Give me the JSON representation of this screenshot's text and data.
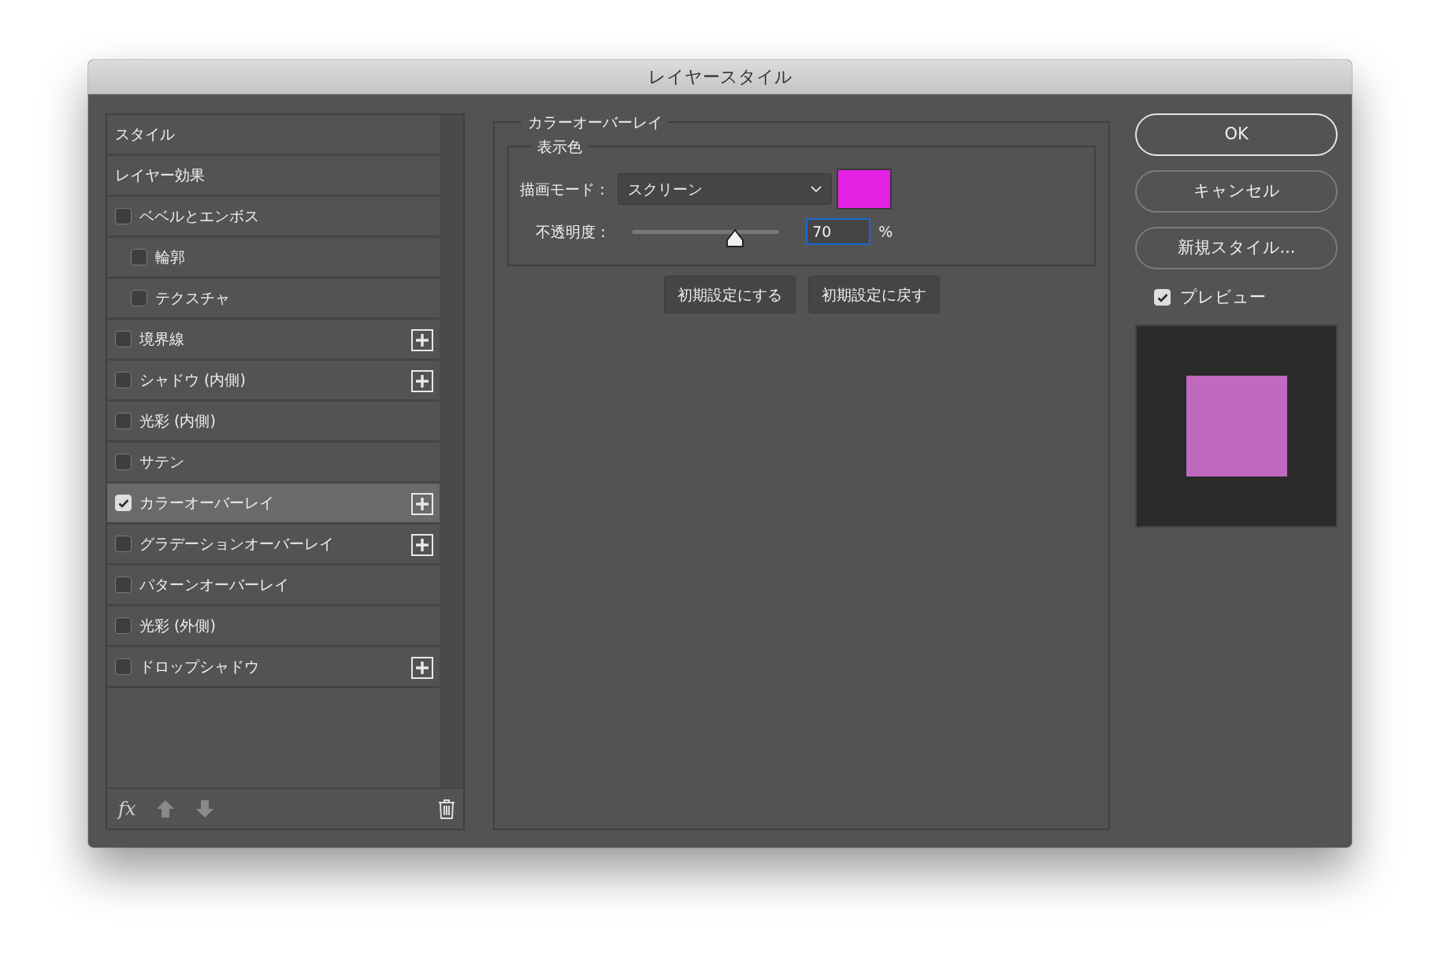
{
  "window": {
    "title": "レイヤースタイル"
  },
  "sidebar": {
    "items": [
      {
        "kind": "header",
        "label": "スタイル",
        "selected": false
      },
      {
        "kind": "header",
        "label": "レイヤー効果",
        "selected": false
      },
      {
        "kind": "effect",
        "label": "ベベルとエンボス",
        "checked": false,
        "selected": false,
        "addable": false,
        "children": [
          {
            "kind": "effect",
            "label": "輪郭",
            "checked": false,
            "selected": false,
            "addable": false
          },
          {
            "kind": "effect",
            "label": "テクスチャ",
            "checked": false,
            "selected": false,
            "addable": false
          }
        ]
      },
      {
        "kind": "effect",
        "label": "境界線",
        "checked": false,
        "selected": false,
        "addable": true
      },
      {
        "kind": "effect",
        "label": "シャドウ (内側)",
        "checked": false,
        "selected": false,
        "addable": true
      },
      {
        "kind": "effect",
        "label": "光彩 (内側)",
        "checked": false,
        "selected": false,
        "addable": false
      },
      {
        "kind": "effect",
        "label": "サテン",
        "checked": false,
        "selected": false,
        "addable": false
      },
      {
        "kind": "effect",
        "label": "カラーオーバーレイ",
        "checked": true,
        "selected": true,
        "addable": true
      },
      {
        "kind": "effect",
        "label": "グラデーションオーバーレイ",
        "checked": false,
        "selected": false,
        "addable": true
      },
      {
        "kind": "effect",
        "label": "パターンオーバーレイ",
        "checked": false,
        "selected": false,
        "addable": false
      },
      {
        "kind": "effect",
        "label": "光彩 (外側)",
        "checked": false,
        "selected": false,
        "addable": false
      },
      {
        "kind": "effect",
        "label": "ドロップシャドウ",
        "checked": false,
        "selected": false,
        "addable": true
      }
    ],
    "toolbar": {
      "fx_label": "fx"
    }
  },
  "panel": {
    "title": "カラーオーバーレイ",
    "group": {
      "title": "表示色",
      "blend_mode": {
        "label": "描画モード：",
        "value": "スクリーン",
        "color": "#e321e3"
      },
      "opacity": {
        "label": "不透明度：",
        "level": 0.7,
        "value": "70",
        "unit": "%"
      }
    },
    "buttons": [
      "初期設定にする",
      "初期設定に戻す"
    ]
  },
  "actions": [
    {
      "label": "OK",
      "default": true
    },
    {
      "label": "キャンセル",
      "default": false
    },
    {
      "label": "新規スタイル...",
      "default": false
    }
  ],
  "preview": {
    "label": "プレビュー",
    "checked": true,
    "color": "#c069c0"
  }
}
